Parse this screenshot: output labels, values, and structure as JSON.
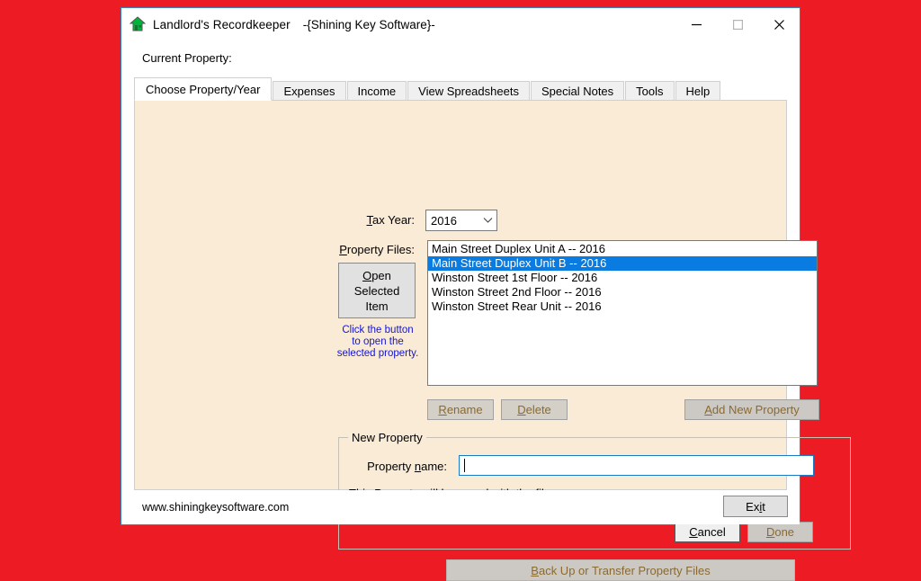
{
  "window": {
    "icon": "house-icon",
    "title": "Landlord's Recordkeeper",
    "subtitle": "-{Shining Key Software}-",
    "minimize_label": "–",
    "maximize_label": "□",
    "close_label": "✕"
  },
  "header": {
    "current_property_label": "Current Property:",
    "current_property_value": ""
  },
  "tabs": [
    {
      "label": "Choose Property/Year",
      "active": true
    },
    {
      "label": "Expenses",
      "active": false
    },
    {
      "label": "Income",
      "active": false
    },
    {
      "label": "View Spreadsheets",
      "active": false
    },
    {
      "label": "Special Notes",
      "active": false
    },
    {
      "label": "Tools",
      "active": false
    },
    {
      "label": "Help",
      "active": false
    }
  ],
  "form": {
    "tax_year_label_pre": "T",
    "tax_year_label_post": "ax Year:",
    "tax_year_value": "2016",
    "tax_year_arrow": "⌄",
    "property_files_label_pre": "P",
    "property_files_label_post": "roperty Files:",
    "open_button_line1_pre": "O",
    "open_button_line1_post": "pen",
    "open_button_line2": "Selected",
    "open_button_line3": "Item",
    "hint_line1": "Click the button",
    "hint_line2": "to open the",
    "hint_line3": "selected property."
  },
  "property_files": [
    {
      "name": "Main Street Duplex Unit A -- 2016",
      "selected": false
    },
    {
      "name": "Main Street Duplex Unit B -- 2016",
      "selected": true
    },
    {
      "name": "Winston Street 1st Floor -- 2016",
      "selected": false
    },
    {
      "name": "Winston Street 2nd Floor -- 2016",
      "selected": false
    },
    {
      "name": "Winston Street Rear Unit -- 2016",
      "selected": false
    }
  ],
  "actions": {
    "rename_pre": "R",
    "rename_post": "ename",
    "delete_pre": "D",
    "delete_post": "elete",
    "add_new_pre": "A",
    "add_new_post": "dd New Property"
  },
  "new_property": {
    "group_title": "New Property",
    "name_label_pre": "Property ",
    "name_label_mid": "n",
    "name_label_post": "ame:",
    "name_value": "",
    "note": "This Property will be saved with the file name...",
    "cancel_pre": "C",
    "cancel_post": "ancel",
    "done_pre": "D",
    "done_post": "one"
  },
  "backup": {
    "label_pre": "B",
    "label_post": "ack Up or Transfer Property Files"
  },
  "status": {
    "url": "www.shiningkeysoftware.com",
    "exit_pre": "Ex",
    "exit_mid": "i",
    "exit_post": "t"
  },
  "colors": {
    "desktop_background": "#ED1C24",
    "panel_background": "#FAEBD7",
    "selection_blue": "#0A7BE0",
    "hint_blue": "#1414D2",
    "disabled_text": "#8A6A2F"
  }
}
